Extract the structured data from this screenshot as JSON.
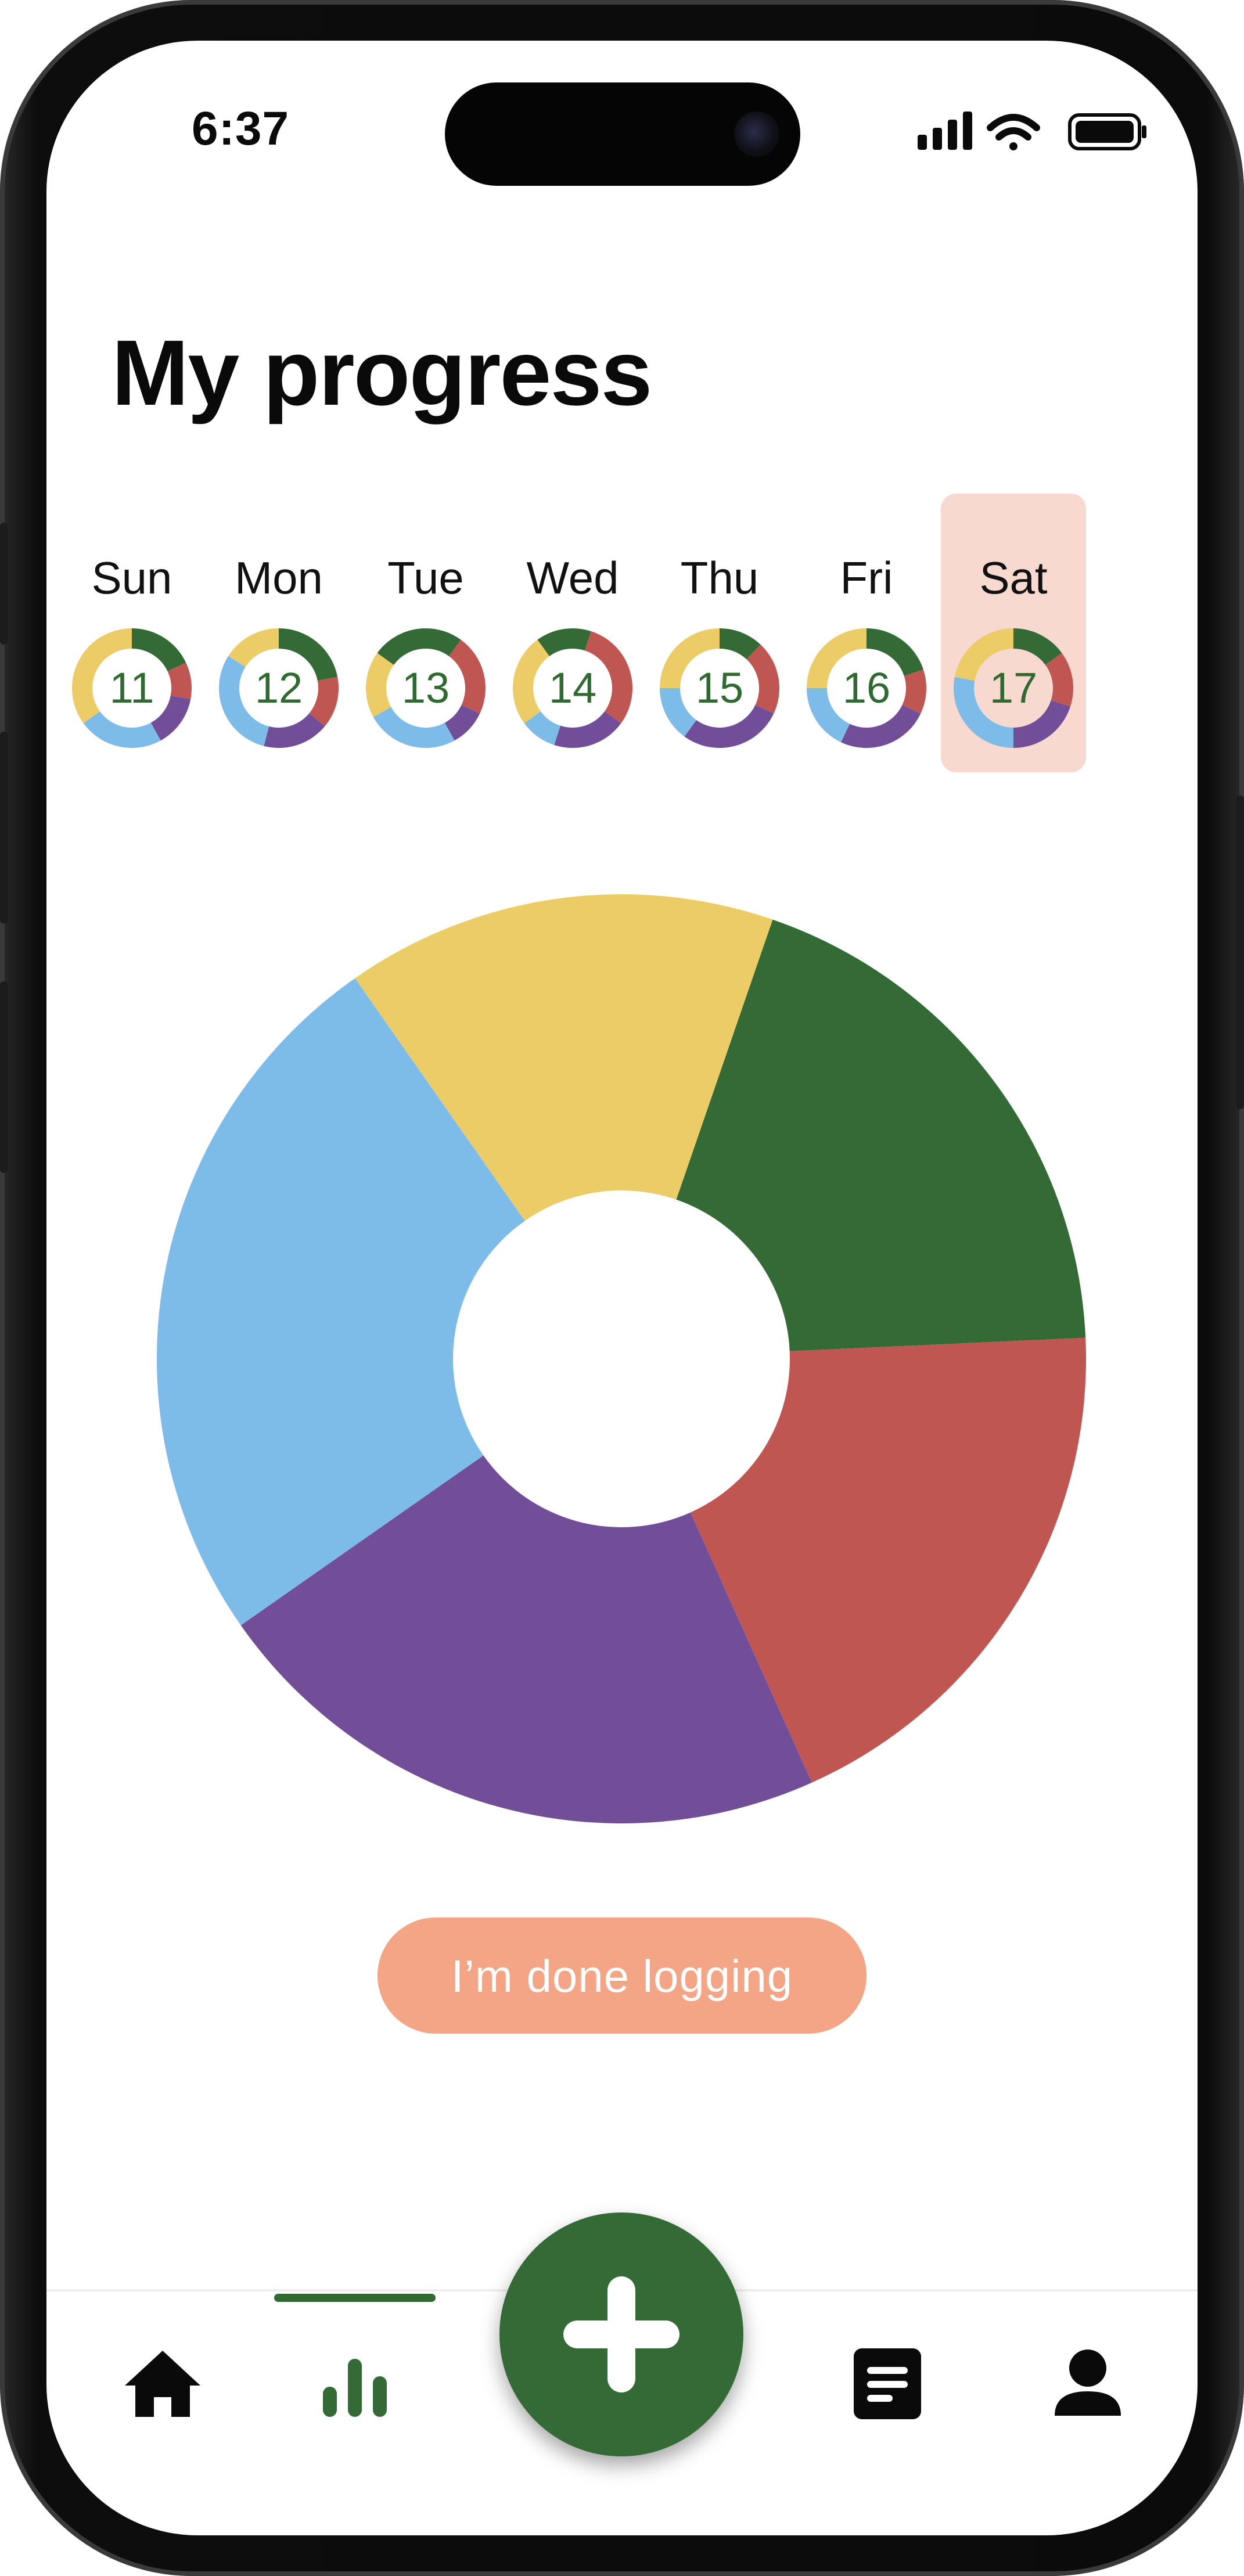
{
  "status_bar": {
    "time": "6:37",
    "icons": [
      "cellular-signal-icon",
      "wifi-icon",
      "battery-icon"
    ]
  },
  "page": {
    "title": "My progress"
  },
  "colors": {
    "green": "#336a36",
    "red": "#c05652",
    "purple": "#724d98",
    "blue": "#7dbbe9",
    "yellow": "#ebcc66",
    "selected_day_bg": "#f8d9cf",
    "button_bg": "#f4a585"
  },
  "week": {
    "selected_index": 6,
    "days": [
      {
        "label": "Sun",
        "date": "11",
        "segments": [
          0.18,
          0.1,
          0.14,
          0.23,
          0.35
        ]
      },
      {
        "label": "Mon",
        "date": "12",
        "segments": [
          0.22,
          0.14,
          0.18,
          0.3,
          0.16
        ]
      },
      {
        "label": "Tue",
        "date": "13",
        "segments": [
          0.1,
          0.22,
          0.1,
          0.25,
          0.18,
          0.15
        ]
      },
      {
        "label": "Wed",
        "date": "14",
        "segments": [
          0.05,
          0.3,
          0.2,
          0.1,
          0.25,
          0.1
        ]
      },
      {
        "label": "Thu",
        "date": "15",
        "segments": [
          0.12,
          0.2,
          0.28,
          0.15,
          0.25
        ]
      },
      {
        "label": "Fri",
        "date": "16",
        "segments": [
          0.2,
          0.12,
          0.25,
          0.18,
          0.25
        ]
      },
      {
        "label": "Sat",
        "date": "17",
        "segments": [
          0.15,
          0.15,
          0.2,
          0.28,
          0.22
        ]
      }
    ]
  },
  "chart_data": {
    "type": "pie",
    "slices": [
      {
        "color": "#336a36",
        "value": 0.19
      },
      {
        "color": "#c05652",
        "value": 0.19
      },
      {
        "color": "#724d98",
        "value": 0.22
      },
      {
        "color": "#7dbbe9",
        "value": 0.25
      },
      {
        "color": "#ebcc66",
        "value": 0.15
      }
    ],
    "donut": true
  },
  "actions": {
    "done_label": "I’m done logging"
  },
  "nav": {
    "items": [
      {
        "icon": "home-icon",
        "active": false
      },
      {
        "icon": "stats-icon",
        "active": true
      },
      {
        "icon": "add-icon",
        "active": false
      },
      {
        "icon": "journal-icon",
        "active": false
      },
      {
        "icon": "profile-icon",
        "active": false
      }
    ]
  }
}
